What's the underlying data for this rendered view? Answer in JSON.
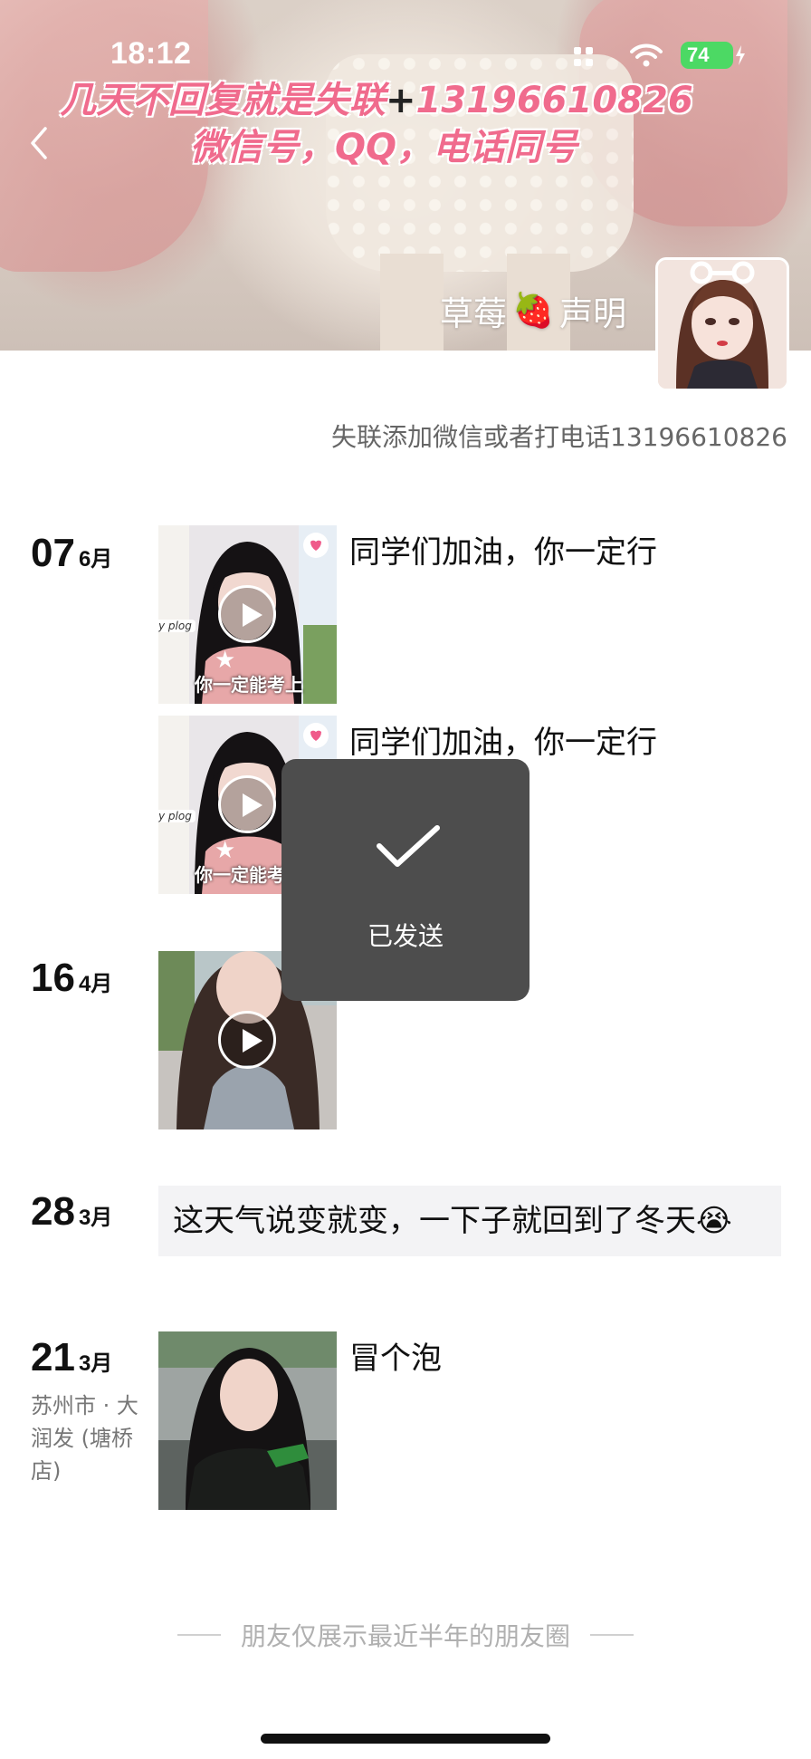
{
  "status_bar": {
    "time": "18:12",
    "battery": "74"
  },
  "cover": {
    "promo_line1_a": "几天不回复就是失联",
    "promo_plus": "+",
    "promo_line1_b": "13196610826",
    "promo_line2": "微信号，QQ，电话同号"
  },
  "profile": {
    "nickname_a": "草莓",
    "nickname_emoji": "🍓",
    "nickname_b": "声明",
    "signature": "失联添加微信或者打电话13196610826"
  },
  "posts": [
    {
      "day": "07",
      "month": "6月",
      "text": "同学们加油，你一定行",
      "thumb_caption": "你一定能考上",
      "thumb_tag": "y plog"
    },
    {
      "text": "同学们加油，你一定行",
      "thumb_caption": "你一定能考",
      "thumb_tag": "y plog"
    },
    {
      "day": "16",
      "month": "4月"
    },
    {
      "day": "28",
      "month": "3月",
      "text": "这天气说变就变，一下子就回到了冬天😭"
    },
    {
      "day": "21",
      "month": "3月",
      "location": "苏州市 · 大润发 (塘桥店)",
      "text": "冒个泡"
    }
  ],
  "toast": {
    "label": "已发送"
  },
  "footer": {
    "text": "朋友仅展示最近半年的朋友圈"
  },
  "colors": {
    "promo_pink": "#f06b8d",
    "battery_green": "#4cd964",
    "toast_bg": "#4d4d4d"
  },
  "icons": [
    "back-chevron-icon",
    "signal-icon",
    "wifi-icon",
    "battery-icon",
    "play-icon",
    "checkmark-icon"
  ]
}
